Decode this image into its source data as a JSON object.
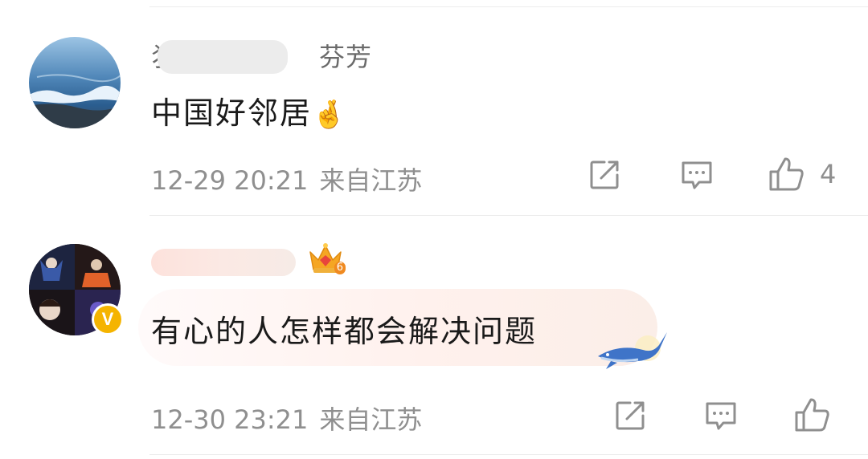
{
  "comments": [
    {
      "username_visible": "芬芳",
      "username_prefix": "犭",
      "content": "中国好邻居",
      "content_emoji": "🤞",
      "timestamp": "12-29 20:21",
      "location": "来自江苏",
      "likes": "4"
    },
    {
      "content": "有心的人怎样都会解决问题",
      "timestamp": "12-30 23:21",
      "location": "来自江苏",
      "badge_level": "6",
      "verified_label": "V"
    }
  ],
  "icons": {
    "share": "share-icon",
    "reply": "comment-icon",
    "like": "thumbs-up-icon"
  },
  "colors": {
    "meta_text": "#8f8f8f",
    "username": "#6a6a6a",
    "verified": "#f5b400",
    "crown": "#f5a623"
  }
}
